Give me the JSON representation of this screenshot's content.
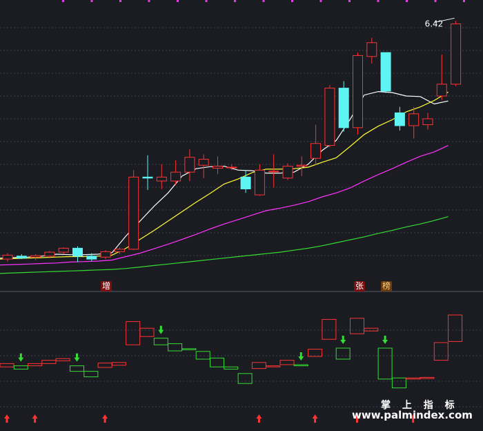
{
  "colors": {
    "background": "#1b1c22",
    "grid": "#3a3f52",
    "up": "#ff3333",
    "down": "#5ff4f4",
    "ma5": "#ffffff",
    "ma10": "#ffff33",
    "ma20": "#ff33ff",
    "ma60": "#33dd33",
    "indicator_up": "#ff3333",
    "indicator_down": "#33dd33",
    "top_dots": "#e040e0"
  },
  "chart_data": [
    {
      "type": "candlestick",
      "title": "",
      "price_axis": {
        "ymin": 1.28,
        "ymax": 6.62
      },
      "grid": true,
      "highest_label": "6.42",
      "candles": [
        {
          "o": 1.6,
          "h": 1.72,
          "l": 1.55,
          "c": 1.68
        },
        {
          "o": 1.66,
          "h": 1.7,
          "l": 1.6,
          "c": 1.62
        },
        {
          "o": 1.64,
          "h": 1.7,
          "l": 1.58,
          "c": 1.67
        },
        {
          "o": 1.66,
          "h": 1.76,
          "l": 1.62,
          "c": 1.74
        },
        {
          "o": 1.74,
          "h": 1.84,
          "l": 1.7,
          "c": 1.82
        },
        {
          "o": 1.82,
          "h": 1.86,
          "l": 1.54,
          "c": 1.66
        },
        {
          "o": 1.66,
          "h": 1.72,
          "l": 1.56,
          "c": 1.6
        },
        {
          "o": 1.64,
          "h": 1.78,
          "l": 1.6,
          "c": 1.75
        },
        {
          "o": 1.75,
          "h": 1.84,
          "l": 1.7,
          "c": 1.8
        },
        {
          "o": 1.8,
          "h": 3.4,
          "l": 1.78,
          "c": 3.26
        },
        {
          "o": 3.26,
          "h": 3.7,
          "l": 3.0,
          "c": 3.24
        },
        {
          "o": 3.18,
          "h": 3.52,
          "l": 3.02,
          "c": 3.26
        },
        {
          "o": 3.18,
          "h": 3.6,
          "l": 3.1,
          "c": 3.36
        },
        {
          "o": 3.36,
          "h": 3.82,
          "l": 3.18,
          "c": 3.66
        },
        {
          "o": 3.5,
          "h": 3.72,
          "l": 3.24,
          "c": 3.62
        },
        {
          "o": 3.44,
          "h": 3.68,
          "l": 3.32,
          "c": 3.48
        },
        {
          "o": 3.46,
          "h": 3.52,
          "l": 3.4,
          "c": 3.46
        },
        {
          "o": 3.26,
          "h": 3.4,
          "l": 2.94,
          "c": 3.02
        },
        {
          "o": 2.9,
          "h": 3.52,
          "l": 2.88,
          "c": 3.4
        },
        {
          "o": 3.37,
          "h": 3.72,
          "l": 3.05,
          "c": 3.38
        },
        {
          "o": 3.24,
          "h": 3.54,
          "l": 3.2,
          "c": 3.48
        },
        {
          "o": 3.48,
          "h": 3.68,
          "l": 3.28,
          "c": 3.5
        },
        {
          "o": 3.64,
          "h": 4.32,
          "l": 3.5,
          "c": 3.94
        },
        {
          "o": 3.9,
          "h": 5.12,
          "l": 3.86,
          "c": 5.06
        },
        {
          "o": 5.06,
          "h": 5.2,
          "l": 4.18,
          "c": 4.26
        },
        {
          "o": 4.26,
          "h": 5.78,
          "l": 4.12,
          "c": 5.72
        },
        {
          "o": 5.7,
          "h": 6.08,
          "l": 5.56,
          "c": 5.98
        },
        {
          "o": 5.78,
          "h": 5.78,
          "l": 4.96,
          "c": 5.0
        },
        {
          "o": 4.56,
          "h": 4.68,
          "l": 4.2,
          "c": 4.3
        },
        {
          "o": 4.3,
          "h": 4.68,
          "l": 4.04,
          "c": 4.54
        },
        {
          "o": 4.32,
          "h": 4.56,
          "l": 4.22,
          "c": 4.44
        },
        {
          "o": 4.9,
          "h": 5.74,
          "l": 4.82,
          "c": 5.14
        },
        {
          "o": 5.14,
          "h": 6.42,
          "l": 5.1,
          "c": 6.36
        }
      ],
      "moving_averages": [
        {
          "id": "ma5",
          "values": [
            1.62,
            1.63,
            1.64,
            1.66,
            1.7,
            1.69,
            1.69,
            1.7,
            1.73,
            2.07,
            2.37,
            2.67,
            2.94,
            3.28,
            3.43,
            3.47,
            3.48,
            3.4,
            3.39,
            3.34,
            3.34,
            3.36,
            3.52,
            3.8,
            4.0,
            4.43,
            4.92,
            4.99,
            4.97,
            4.9,
            4.89,
            4.74,
            4.8
          ]
        },
        {
          "id": "ma10",
          "values": [
            1.6,
            1.61,
            1.62,
            1.63,
            1.64,
            1.65,
            1.65,
            1.66,
            1.68,
            1.82,
            2.0,
            2.18,
            2.37,
            2.56,
            2.75,
            2.93,
            3.12,
            3.22,
            3.35,
            3.42,
            3.42,
            3.43,
            3.46,
            3.56,
            3.65,
            3.88,
            4.12,
            4.29,
            4.42,
            4.58,
            4.68,
            4.81,
            4.98
          ]
        },
        {
          "id": "ma20",
          "values": [
            1.48,
            1.49,
            1.5,
            1.51,
            1.52,
            1.54,
            1.55,
            1.56,
            1.58,
            1.65,
            1.72,
            1.81,
            1.9,
            2.0,
            2.1,
            2.21,
            2.31,
            2.4,
            2.49,
            2.58,
            2.63,
            2.69,
            2.76,
            2.86,
            2.94,
            3.04,
            3.18,
            3.31,
            3.43,
            3.56,
            3.68,
            3.77,
            3.9
          ]
        },
        {
          "id": "ma60",
          "values": [
            1.31,
            1.32,
            1.33,
            1.34,
            1.35,
            1.36,
            1.37,
            1.38,
            1.39,
            1.41,
            1.44,
            1.47,
            1.5,
            1.53,
            1.56,
            1.59,
            1.62,
            1.65,
            1.68,
            1.71,
            1.74,
            1.78,
            1.82,
            1.87,
            1.93,
            1.99,
            2.05,
            2.12,
            2.18,
            2.25,
            2.31,
            2.38,
            2.46
          ]
        }
      ],
      "markers": [
        {
          "index": 7,
          "label": "增"
        },
        {
          "index": 25,
          "label": "张"
        },
        {
          "index": 27,
          "label": "榜"
        }
      ]
    },
    {
      "type": "box-indicator",
      "range": {
        "ymin": 0,
        "ymax": 10
      },
      "boxes": [
        {
          "top": 4.6,
          "bottom": 4.3,
          "up": true
        },
        {
          "top": 4.4,
          "bottom": 4.1,
          "up": false
        },
        {
          "top": 4.6,
          "bottom": 4.4,
          "up": true
        },
        {
          "top": 4.9,
          "bottom": 4.6,
          "up": true
        },
        {
          "top": 5.05,
          "bottom": 4.85,
          "up": true
        },
        {
          "top": 4.4,
          "bottom": 3.9,
          "up": false
        },
        {
          "top": 3.9,
          "bottom": 3.4,
          "up": false
        },
        {
          "top": 4.65,
          "bottom": 4.25,
          "up": true
        },
        {
          "top": 4.7,
          "bottom": 4.45,
          "up": true
        },
        {
          "top": 8.4,
          "bottom": 6.3,
          "up": true
        },
        {
          "top": 7.8,
          "bottom": 7.05,
          "up": true
        },
        {
          "top": 6.9,
          "bottom": 6.3,
          "up": false
        },
        {
          "top": 6.4,
          "bottom": 5.75,
          "up": false
        },
        {
          "top": 5.95,
          "bottom": 5.85,
          "up": false
        },
        {
          "top": 5.7,
          "bottom": 5.0,
          "up": false
        },
        {
          "top": 5.1,
          "bottom": 4.3,
          "up": false
        },
        {
          "top": 4.3,
          "bottom": 4.1,
          "up": false
        },
        {
          "top": 3.7,
          "bottom": 2.8,
          "up": false
        },
        {
          "top": 4.7,
          "bottom": 4.15,
          "up": true
        },
        {
          "top": 4.4,
          "bottom": 4.3,
          "up": true
        },
        {
          "top": 4.9,
          "bottom": 4.5,
          "up": true
        },
        {
          "top": 4.5,
          "bottom": 4.4,
          "up": false
        },
        {
          "top": 5.9,
          "bottom": 5.25,
          "up": true
        },
        {
          "top": 8.6,
          "bottom": 6.8,
          "up": true
        },
        {
          "top": 6.0,
          "bottom": 5.0,
          "up": false
        },
        {
          "top": 8.7,
          "bottom": 7.3,
          "up": true
        },
        {
          "top": 7.8,
          "bottom": 7.55,
          "up": true
        },
        {
          "top": 6.0,
          "bottom": 3.2,
          "up": false
        },
        {
          "top": 3.3,
          "bottom": 2.4,
          "up": false
        },
        {
          "top": 3.3,
          "bottom": 3.2,
          "up": true
        },
        {
          "top": 3.35,
          "bottom": 3.25,
          "up": true
        },
        {
          "top": 6.5,
          "bottom": 4.9,
          "up": true
        },
        {
          "top": 9.0,
          "bottom": 6.6,
          "up": true
        }
      ],
      "signals": [
        {
          "index": 0,
          "dir": "up"
        },
        {
          "index": 1,
          "dir": "down"
        },
        {
          "index": 2,
          "dir": "up"
        },
        {
          "index": 5,
          "dir": "down"
        },
        {
          "index": 7,
          "dir": "up"
        },
        {
          "index": 11,
          "dir": "down"
        },
        {
          "index": 18,
          "dir": "up"
        },
        {
          "index": 21,
          "dir": "down"
        },
        {
          "index": 22,
          "dir": "up"
        },
        {
          "index": 24,
          "dir": "down"
        },
        {
          "index": 25,
          "dir": "up"
        },
        {
          "index": 27,
          "dir": "down"
        },
        {
          "index": 29,
          "dir": "up"
        }
      ]
    }
  ],
  "watermark": {
    "title": "掌 上 指 标",
    "url": "www.palmindex.com"
  }
}
